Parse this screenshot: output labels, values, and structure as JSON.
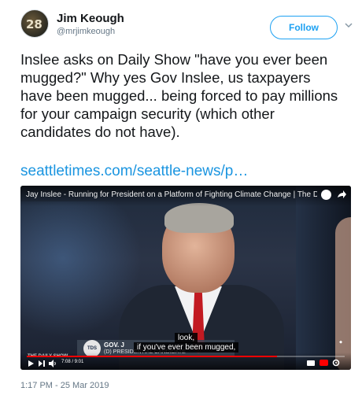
{
  "author": {
    "name": "Jim Keough",
    "handle": "@mrjimkeough",
    "avatar_text": "28",
    "follow_label": "Follow"
  },
  "tweet": {
    "text": "Inslee asks on Daily Show \"have you ever been mugged?\" Why yes Gov Inslee, us taxpayers have been mugged... being forced to pay millions for your campaign security (which other candidates do not have).",
    "link": "seattletimes.com/seattle-news/p…",
    "timestamp": "1:17 PM - 25 Mar 2019"
  },
  "video": {
    "title": "Jay Inslee - Running for President on a Platform of Fighting Climate Change | The Daily Show",
    "caption_line1": "look,",
    "caption_line2": "if you've ever been mugged,",
    "lower_third_name": "GOV. J",
    "lower_third_sub": "(D) PRESIDENTIAL CANDIDATE",
    "logo_text": "TDS",
    "channel_text": "THE DAILY SHOW",
    "time": "7:08 / 9:01",
    "progress": 0.786,
    "icons": [
      "clock-icon",
      "share-icon",
      "play-icon",
      "next-icon",
      "volume-icon",
      "cc-icon",
      "youtube-icon",
      "settings-icon"
    ]
  },
  "colors": {
    "link": "#1b95e0",
    "follow": "#1da1f2",
    "secondary_text": "#657786",
    "progress": "#ff0000"
  }
}
